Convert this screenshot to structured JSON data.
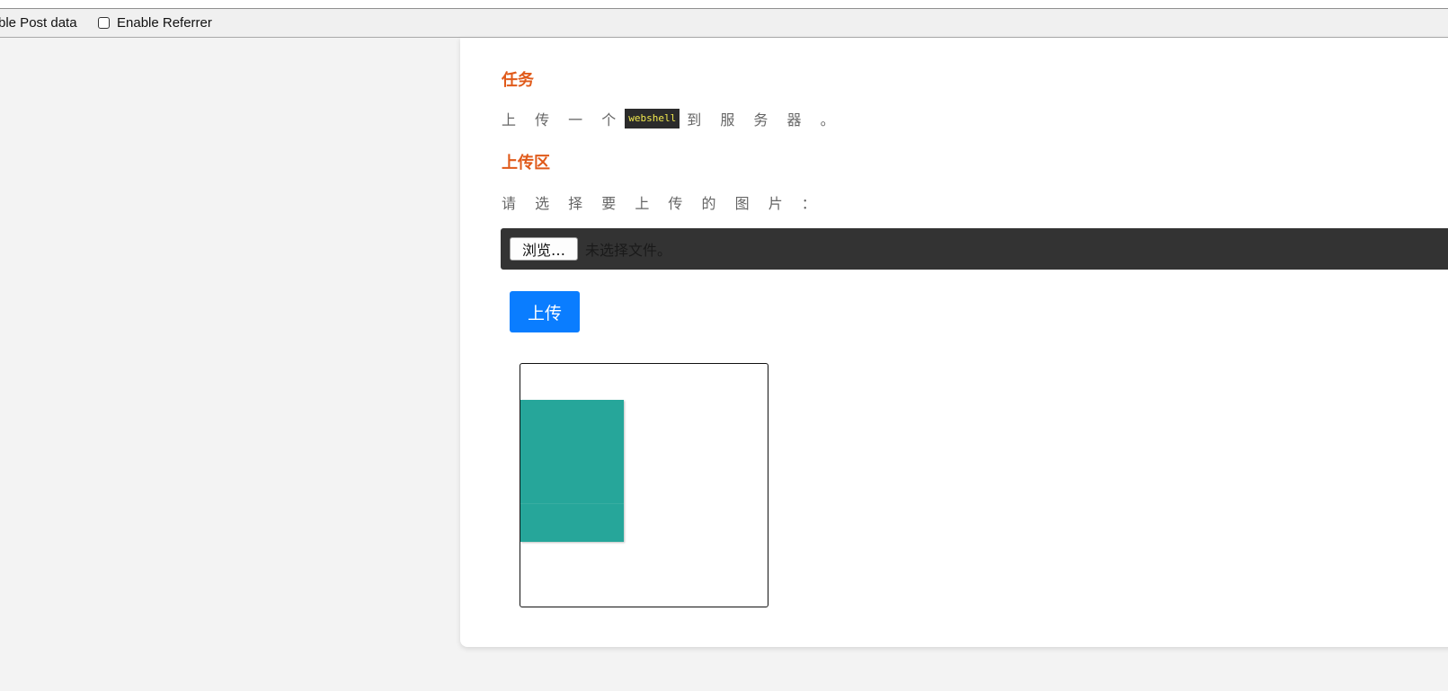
{
  "hackbar": {
    "post_label": "ble Post data",
    "referrer_label": "Enable Referrer",
    "referrer_checked": false
  },
  "content": {
    "task_heading": "任务",
    "task_prefix": "上 传 一 个",
    "task_code": "webshell",
    "task_suffix": "到 服 务 器 。",
    "upload_heading": "上传区",
    "upload_prompt": "请 选 择 要 上 传 的 图 片 ：",
    "browse_label": "浏览…",
    "no_file_text": "未选择文件。",
    "upload_button": "上传"
  },
  "colors": {
    "heading": "#e05a1a",
    "upload_button": "#0a7dff",
    "file_bar": "#333333",
    "code_text": "#f2e94e",
    "thumbnail": "#26a69a"
  },
  "icons": {
    "referrer_checkbox": "checkbox-unchecked-icon"
  }
}
